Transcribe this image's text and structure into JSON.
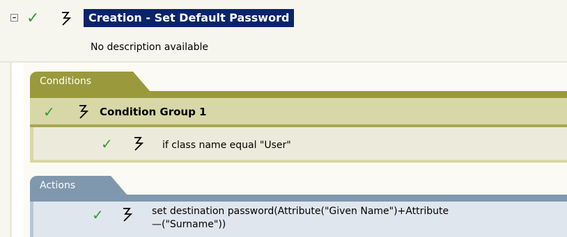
{
  "rule": {
    "title": "Creation - Set Default Password",
    "description": "No description available",
    "enabled_icon": "check-icon",
    "type_icon": "lightning-icon"
  },
  "conditions": {
    "tab_label": "Conditions",
    "group": {
      "label": "Condition Group 1",
      "items": [
        {
          "label": "if class name equal \"User\""
        }
      ]
    }
  },
  "actions": {
    "tab_label": "Actions",
    "items": [
      {
        "line1": "set destination password(Attribute(\"Given Name\")+Attribute",
        "line2": "—(\"Surname\"))"
      }
    ]
  },
  "colors": {
    "selection": "#0a246a",
    "check": "#2e9d2e",
    "conditions_tab": "#9a9a3c",
    "conditions_group": "#d8d7a7",
    "actions_tab": "#7f98ad",
    "actions_row": "#e0e6ee"
  }
}
